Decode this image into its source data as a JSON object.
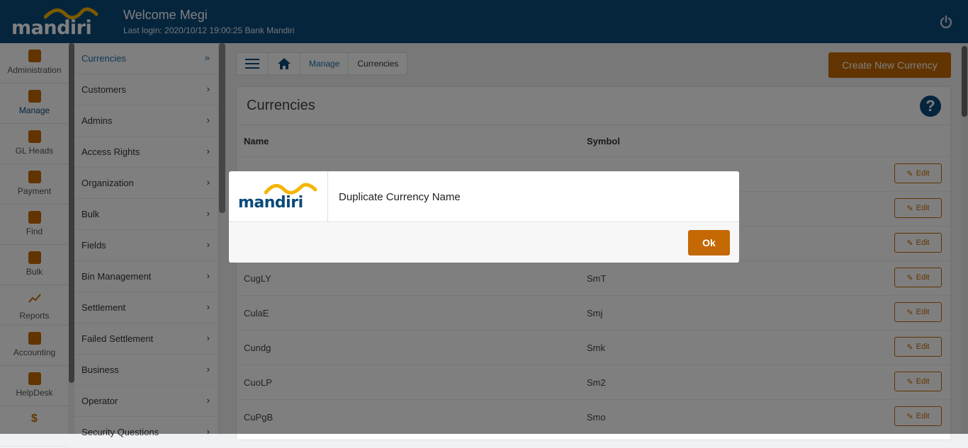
{
  "header": {
    "logo_text": "mandiri",
    "welcome": "Welcome Megi",
    "last_login": "Last login: 2020/10/12 19:00:25 Bank Mandiri"
  },
  "rail": {
    "items": [
      {
        "label": "Administration",
        "icon": "user-badge-icon"
      },
      {
        "label": "Manage",
        "icon": "plus-box-icon"
      },
      {
        "label": "GL Heads",
        "icon": "wallet-icon"
      },
      {
        "label": "Payment",
        "icon": "card-icon"
      },
      {
        "label": "Find",
        "icon": "search-doc-icon"
      },
      {
        "label": "Bulk",
        "icon": "book-icon"
      },
      {
        "label": "Reports",
        "icon": "trend-icon"
      },
      {
        "label": "Accounting",
        "icon": "ledger-icon"
      },
      {
        "label": "HelpDesk",
        "icon": "help-icon"
      },
      {
        "label": "",
        "icon": "dollar-icon"
      }
    ]
  },
  "submenu": {
    "items": [
      {
        "label": "Currencies",
        "chevron": "»"
      },
      {
        "label": "Customers",
        "chevron": "›"
      },
      {
        "label": "Admins",
        "chevron": "›"
      },
      {
        "label": "Access Rights",
        "chevron": "›"
      },
      {
        "label": "Organization",
        "chevron": "›"
      },
      {
        "label": "Bulk",
        "chevron": "›"
      },
      {
        "label": "Fields",
        "chevron": "›"
      },
      {
        "label": "Bin Management",
        "chevron": "›"
      },
      {
        "label": "Settlement",
        "chevron": "›"
      },
      {
        "label": "Failed Settlement",
        "chevron": "›"
      },
      {
        "label": "Business",
        "chevron": "›"
      },
      {
        "label": "Operator",
        "chevron": "›"
      },
      {
        "label": "Security Questions",
        "chevron": "›"
      }
    ]
  },
  "breadcrumb": {
    "manage": "Manage",
    "current": "Currencies"
  },
  "create_button": "Create New Currency",
  "panel": {
    "title": "Currencies",
    "help": "?",
    "col_name": "Name",
    "col_symbol": "Symbol",
    "edit_label": "Edit",
    "rows": [
      {
        "name": "",
        "symbol": ""
      },
      {
        "name": "",
        "symbol": ""
      },
      {
        "name": "",
        "symbol": ""
      },
      {
        "name": "CugLY",
        "symbol": "SmT"
      },
      {
        "name": "CulaE",
        "symbol": "Smj"
      },
      {
        "name": "Cundg",
        "symbol": "Smk"
      },
      {
        "name": "CuoLP",
        "symbol": "Sm2"
      },
      {
        "name": "CuPgB",
        "symbol": "Smo"
      }
    ]
  },
  "modal": {
    "logo_text": "mandiri",
    "message": "Duplicate Currency Name",
    "ok": "Ok"
  },
  "colors": {
    "brand_blue": "#0a4a7a",
    "accent_orange": "#c46803",
    "logo_wave": "#f5b400"
  }
}
